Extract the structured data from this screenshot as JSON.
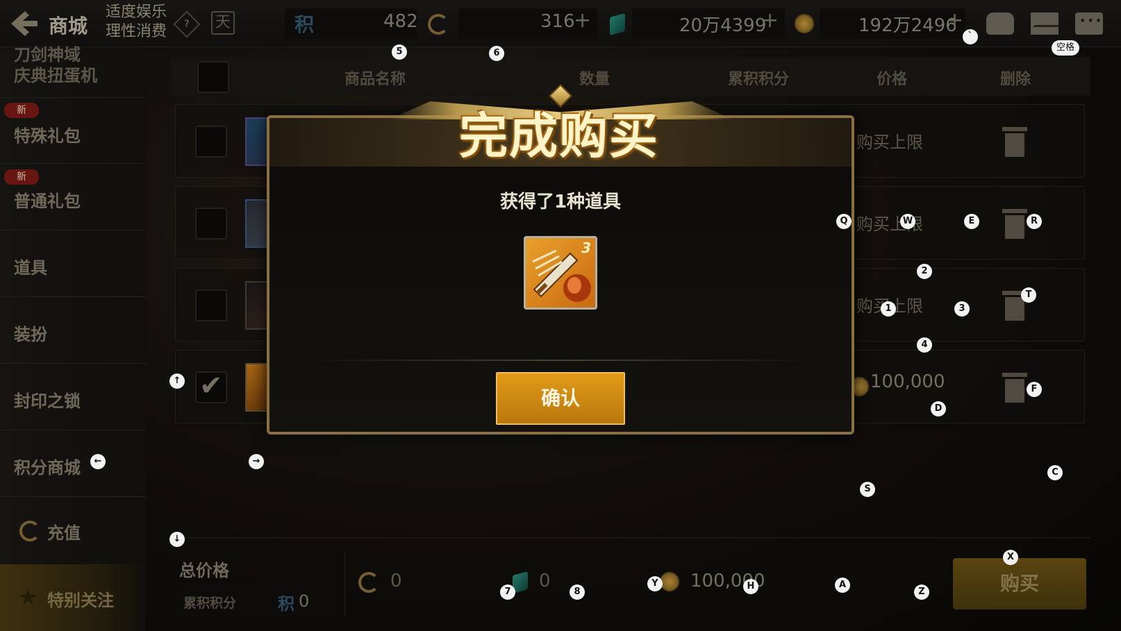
{
  "header": {
    "title": "商城",
    "notice_line1": "适度娱乐",
    "notice_line2": "理性消费",
    "points_symbol": "积",
    "points_value": "482",
    "cera_value": "316",
    "gem_value": "20万4399",
    "gold_value": "192万2496",
    "plus": "+"
  },
  "sidebar": {
    "top_label_line1": "刀剑神域",
    "top_label_line2": "庆典扭蛋机",
    "items": [
      {
        "label": "特殊礼包",
        "badge": "新"
      },
      {
        "label": "普通礼包",
        "badge": "新"
      },
      {
        "label": "道具"
      },
      {
        "label": "装扮"
      },
      {
        "label": "封印之锁"
      },
      {
        "label": "积分商城"
      },
      {
        "label": "充值"
      }
    ],
    "favorite_label": "特别关注"
  },
  "table": {
    "headers": [
      "商品名称",
      "数量",
      "累积积分",
      "价格",
      "删除"
    ],
    "rows": [
      {
        "price": "购买上限",
        "checked": false
      },
      {
        "price": "购买上限",
        "checked": false
      },
      {
        "price": "购买上限",
        "checked": false
      },
      {
        "price": "100,000",
        "checked": true
      }
    ]
  },
  "bottom": {
    "total_label": "总价格",
    "accum_label": "累积积分",
    "accum_symbol": "积",
    "accum_value": "0",
    "cera_total": "0",
    "gem_total": "0",
    "gold_total": "100,000",
    "buy_label": "购买"
  },
  "modal": {
    "title": "完成购买",
    "message": "获得了1种道具",
    "item_count": "3",
    "confirm_label": "确认"
  },
  "hints": {
    "space": "空格",
    "backtick": "`",
    "up": "↑",
    "down": "↓",
    "left": "←",
    "right": "→",
    "k1": "1",
    "k2": "2",
    "k3": "3",
    "k4": "4",
    "k5": "5",
    "k6": "6",
    "k7": "7",
    "k8": "8",
    "Q": "Q",
    "W": "W",
    "E": "E",
    "R": "R",
    "T": "T",
    "F": "F",
    "D": "D",
    "S": "S",
    "C": "C",
    "X": "X",
    "Z": "Z",
    "A": "A",
    "H": "H",
    "Y": "Y"
  }
}
